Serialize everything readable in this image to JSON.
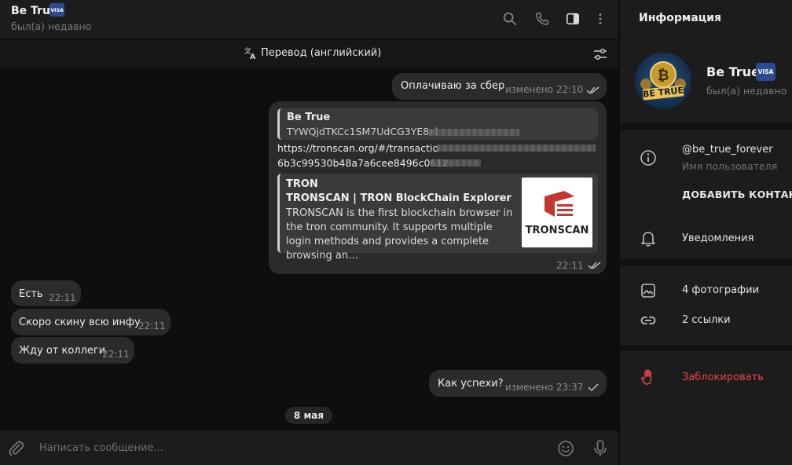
{
  "header": {
    "contact_name": "Be True",
    "badge": "VISA",
    "status": "был(а) недавно"
  },
  "translate_bar": {
    "label": "Перевод (английский)"
  },
  "messages": {
    "m1": {
      "text": "Оплачиваю за сбер",
      "time": "изменено 22:10"
    },
    "m2": {
      "quote_author": "Be True",
      "quote_text": "TYWQjdTKCc1SM7UdCG3YE8xi",
      "link_line1": "https://tronscan.org/#/transactio",
      "link_line2": "6b3c99530b48a7a6cee8496c0612",
      "preview_site": "TRON",
      "preview_title": "TRONSCAN | TRON BlockChain Explorer",
      "preview_desc": "TRONSCAN is the first blockchain browser in the tron community. It supports multiple login methods and provides a complete browsing an…",
      "preview_logo_text": "TRONSCAN",
      "time": "22:11"
    },
    "m3": {
      "text": "Есть",
      "time": "22:11"
    },
    "m4": {
      "text": "Скоро скину всю инфу",
      "time": "22:11"
    },
    "m5": {
      "text": "Жду от коллеги",
      "time": "22:11"
    },
    "m6": {
      "text": "Как успехи?",
      "time": "изменено 23:37"
    }
  },
  "date_chip": "8 мая",
  "composer": {
    "placeholder": "Написать сообщение..."
  },
  "info": {
    "title": "Информация",
    "name": "Be True",
    "badge": "VISA",
    "status": "был(а) недавно",
    "avatar_text": "BE TRUE",
    "username": "@be_true_forever",
    "username_label": "Имя пользователя",
    "add_contact": "ДОБАВИТЬ КОНТАКТ",
    "notifications": "Уведомления",
    "photos": "4 фотографии",
    "links": "2 ссылки",
    "block": "Заблокировать"
  },
  "colors": {
    "accent_danger": "#e5454c",
    "visa_badge": "#2c4a94",
    "tronscan_red": "#c23631"
  },
  "icons": [
    "search-icon",
    "phone-icon",
    "sidebar-toggle-icon",
    "more-vert-icon",
    "translate-icon",
    "translate-settings-icon",
    "attach-icon",
    "emoji-icon",
    "mic-icon",
    "info-icon",
    "bell-icon",
    "photo-icon",
    "link-icon",
    "hand-block-icon",
    "read-check-icon"
  ]
}
